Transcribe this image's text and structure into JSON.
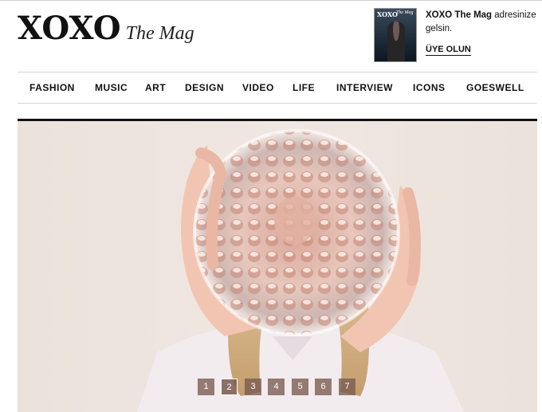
{
  "logo": {
    "main": "XOXO",
    "sub": "The Mag"
  },
  "promo": {
    "cover_title": "XOXO",
    "cover_sub": "The Mag",
    "brand": "XOXO The Mag",
    "text": " adresinize gelsin.",
    "link": "ÜYE OLUN"
  },
  "nav": {
    "items": [
      {
        "label": "FASHION"
      },
      {
        "label": "MUSIC"
      },
      {
        "label": "ART"
      },
      {
        "label": "DESIGN"
      },
      {
        "label": "VIDEO"
      },
      {
        "label": "LIFE"
      },
      {
        "label": "INTERVIEW"
      },
      {
        "label": "ICONS"
      },
      {
        "label": "GOESWELL"
      }
    ]
  },
  "slider": {
    "pages": [
      "1",
      "2",
      "3",
      "4",
      "5",
      "6",
      "7"
    ],
    "active_page": "2"
  },
  "colors": {
    "nav_rule": "#d4d4d4",
    "hero_rule": "#111111",
    "pager_bg": "#785a50"
  }
}
